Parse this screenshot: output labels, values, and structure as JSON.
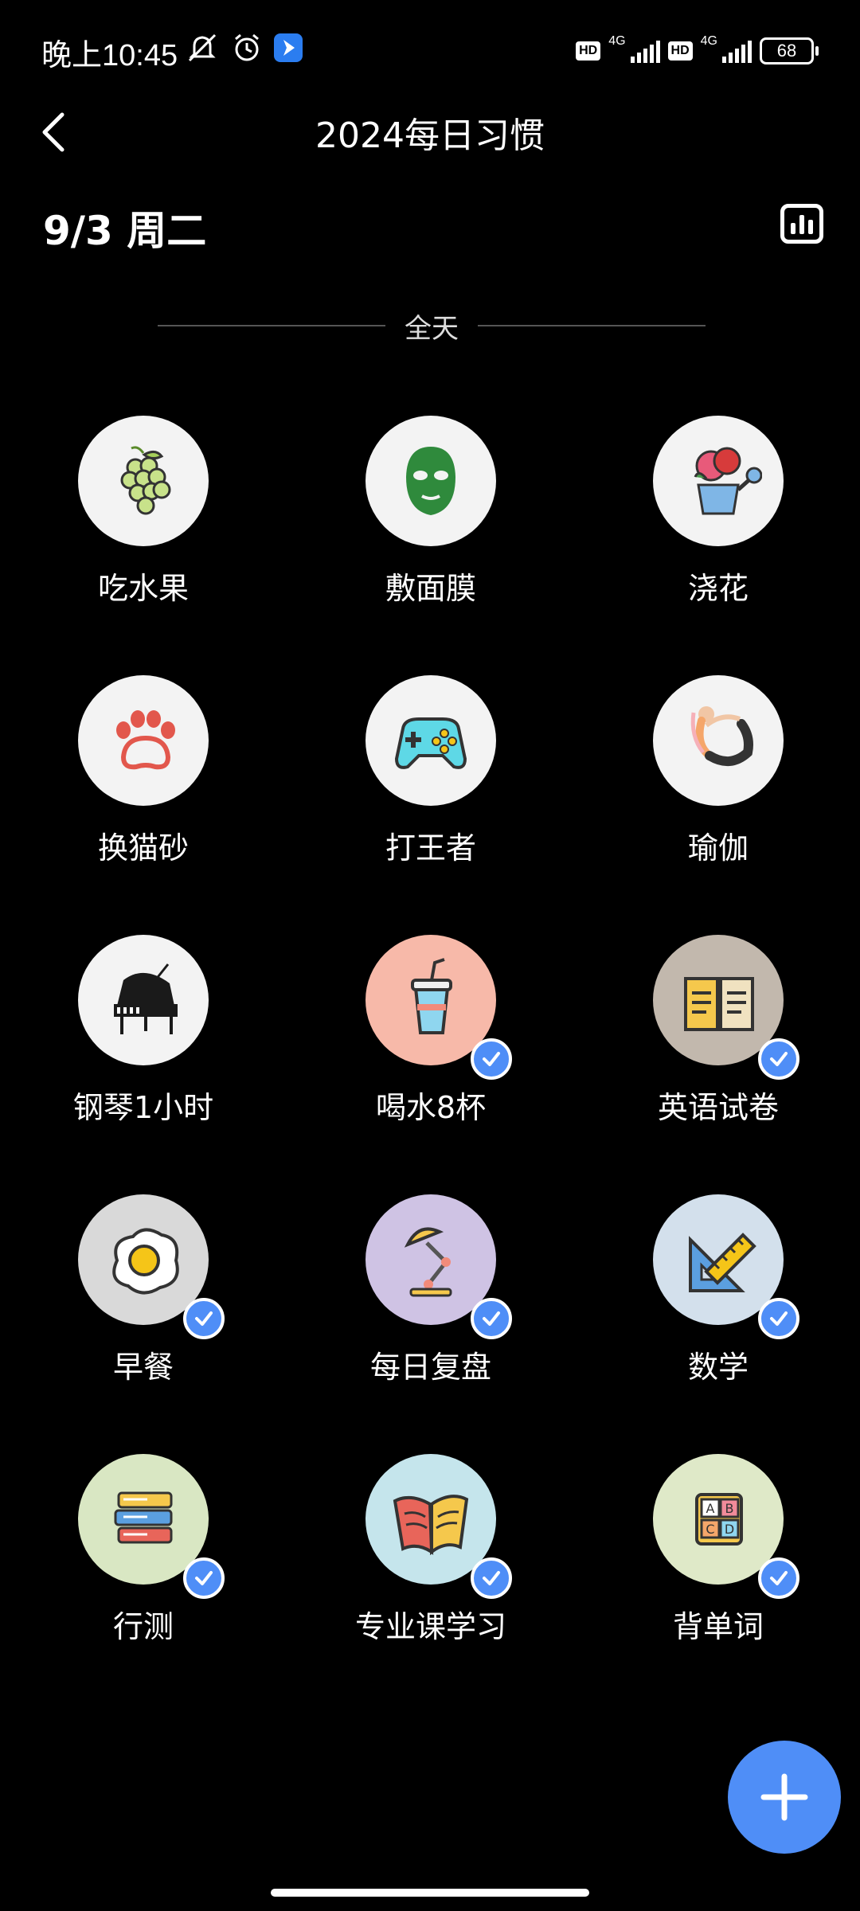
{
  "status_bar": {
    "time": "晚上10:45",
    "network_1": "4G",
    "network_2": "4G",
    "hd_1": "HD",
    "hd_2": "HD",
    "battery": "68"
  },
  "header": {
    "title": "2024每日习惯",
    "date": "9/3 周二"
  },
  "section": {
    "label": "全天"
  },
  "habits": [
    {
      "label": "吃水果",
      "icon": "grapes-icon",
      "bg": "#f3f3f3",
      "done": false
    },
    {
      "label": "敷面膜",
      "icon": "face-mask-icon",
      "bg": "#f3f3f3",
      "done": false
    },
    {
      "label": "浇花",
      "icon": "watering-can-flower-icon",
      "bg": "#f3f3f3",
      "done": false
    },
    {
      "label": "换猫砂",
      "icon": "paw-icon",
      "bg": "#f3f3f3",
      "done": false
    },
    {
      "label": "打王者",
      "icon": "gamepad-icon",
      "bg": "#f3f3f3",
      "done": false
    },
    {
      "label": "瑜伽",
      "icon": "yoga-pose-icon",
      "bg": "#f3f3f3",
      "done": false
    },
    {
      "label": "钢琴1小时",
      "icon": "piano-icon",
      "bg": "#f3f3f3",
      "done": false
    },
    {
      "label": "喝水8杯",
      "icon": "drink-cup-icon",
      "bg": "#f7b9a9",
      "done": true
    },
    {
      "label": "英语试卷",
      "icon": "open-book-icon",
      "bg": "#c2b8ad",
      "done": true
    },
    {
      "label": "早餐",
      "icon": "fried-egg-icon",
      "bg": "#d9d9d9",
      "done": true
    },
    {
      "label": "每日复盘",
      "icon": "desk-lamp-icon",
      "bg": "#cfc3e4",
      "done": true
    },
    {
      "label": "数学",
      "icon": "ruler-triangle-icon",
      "bg": "#d3e0ec",
      "done": true
    },
    {
      "label": "行测",
      "icon": "book-stack-icon",
      "bg": "#d9e7c3",
      "done": true
    },
    {
      "label": "专业课学习",
      "icon": "reading-book-icon",
      "bg": "#c5e5ec",
      "done": true
    },
    {
      "label": "背单词",
      "icon": "abc-blocks-icon",
      "bg": "#dfe9c8",
      "done": true
    }
  ],
  "colors": {
    "accent": "#4f8ef7",
    "background": "#000000"
  }
}
